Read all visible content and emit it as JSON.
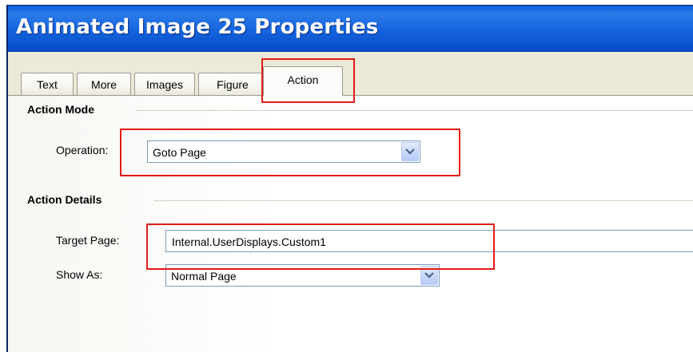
{
  "window": {
    "title": "Animated Image 25 Properties"
  },
  "tabs": [
    {
      "label": "Text"
    },
    {
      "label": "More"
    },
    {
      "label": "Images"
    },
    {
      "label": "Figure"
    },
    {
      "label": "Action"
    }
  ],
  "active_tab": "Action",
  "action_mode": {
    "heading": "Action Mode",
    "operation_label": "Operation:",
    "operation_value": "Goto Page"
  },
  "action_details": {
    "heading": "Action Details",
    "target_label": "Target Page:",
    "target_value": "Internal.UserDisplays.Custom1",
    "show_as_label": "Show As:",
    "show_as_value": "Normal Page"
  },
  "colors": {
    "title_bar": "#1766e0",
    "highlight": "#e41b17",
    "dialog_bg": "#ece9d8"
  },
  "icons": {
    "dropdown": "chevron-down-icon"
  }
}
